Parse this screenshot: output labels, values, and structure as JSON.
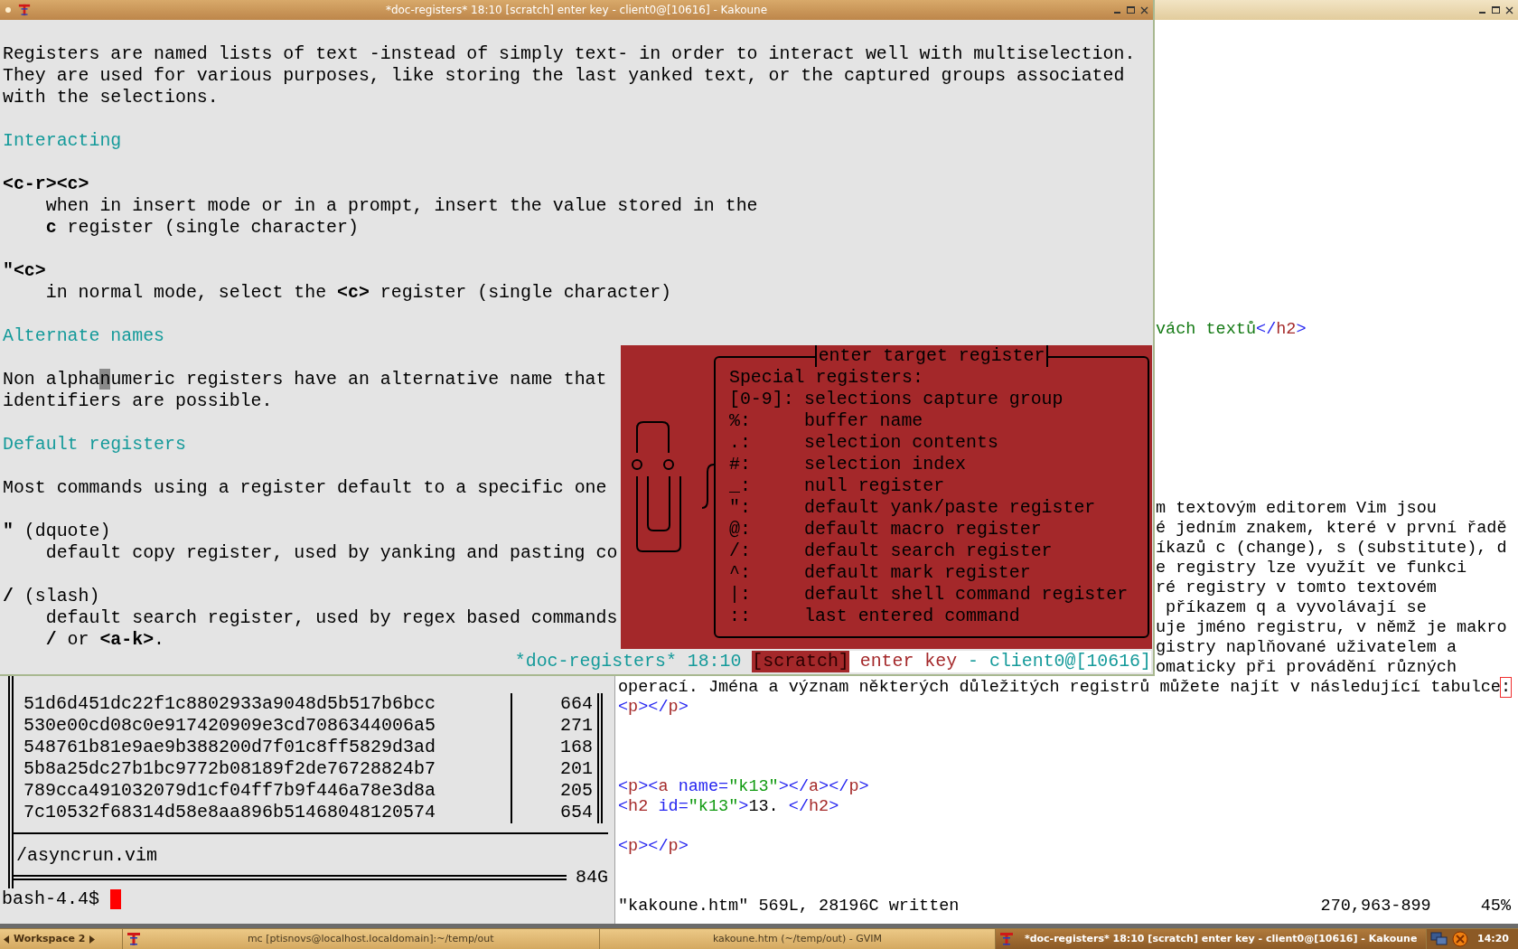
{
  "kakoune": {
    "title": "*doc-registers* 18:10 [scratch] enter key - client0@[10616] - Kakoune",
    "lines": [
      {
        "kind": "blank"
      },
      {
        "kind": "text",
        "text": "Registers are named lists of text -instead of simply text- in order to interact well with multiselection."
      },
      {
        "kind": "text",
        "text": "They are used for various purposes, like storing the last yanked text, or the captured groups associated"
      },
      {
        "kind": "text",
        "text": "with the selections."
      },
      {
        "kind": "blank"
      },
      {
        "kind": "heading",
        "text": "Interacting"
      },
      {
        "kind": "blank"
      },
      {
        "kind": "term",
        "text": "<c-r><c>"
      },
      {
        "kind": "indent",
        "text": "when in insert mode or in a prompt, insert the value stored in the"
      },
      {
        "kind": "indent",
        "text": "**c** register (single character)"
      },
      {
        "kind": "blank"
      },
      {
        "kind": "term",
        "text": "\"<c>"
      },
      {
        "kind": "indent",
        "text": "in normal mode, select the **<c>** register (single character)"
      },
      {
        "kind": "blank"
      },
      {
        "kind": "heading",
        "text": "Alternate names"
      },
      {
        "kind": "blank"
      },
      {
        "kind": "segments",
        "segments": [
          {
            "text": "Non alpha",
            "cursor": false
          },
          {
            "text": "n",
            "cursor": true
          },
          {
            "text": "umeric registers have an alternative name that",
            "cursor": false
          }
        ]
      },
      {
        "kind": "text",
        "text": "identifiers are possible."
      },
      {
        "kind": "blank"
      },
      {
        "kind": "heading",
        "text": "Default registers"
      },
      {
        "kind": "blank"
      },
      {
        "kind": "text",
        "text": "Most commands using a register default to a specific one"
      },
      {
        "kind": "blank"
      },
      {
        "kind": "text",
        "text": "**\"** (dquote)"
      },
      {
        "kind": "indent",
        "text": "default copy register, used by yanking and pasting co"
      },
      {
        "kind": "blank"
      },
      {
        "kind": "text",
        "text": "**/** (slash)"
      },
      {
        "kind": "indent",
        "text": "default search register, used by regex based commands"
      },
      {
        "kind": "indent",
        "text": "**/** or **<a-k>**."
      }
    ],
    "popup": {
      "title": "enter target register",
      "heading": "Special registers:",
      "registers": [
        {
          "key": "[0-9]:",
          "desc": "selections capture group"
        },
        {
          "key": "%:",
          "desc": "buffer name"
        },
        {
          "key": ".:",
          "desc": "selection contents"
        },
        {
          "key": "#:",
          "desc": "selection index"
        },
        {
          "key": "_:",
          "desc": "null register"
        },
        {
          "key": "\":",
          "desc": "default yank/paste register"
        },
        {
          "key": "@:",
          "desc": "default macro register"
        },
        {
          "key": "/:",
          "desc": "default search register"
        },
        {
          "key": "^:",
          "desc": "default mark register"
        },
        {
          "key": "|:",
          "desc": "default shell command register"
        },
        {
          "key": "::",
          "desc": "last entered command"
        }
      ]
    },
    "status": [
      {
        "kind": "buffer",
        "text": "*doc-registers*"
      },
      {
        "kind": "time",
        "text": "18:10"
      },
      {
        "kind": "mode",
        "text": "[scratch]"
      },
      {
        "kind": "prompt",
        "text": "enter key"
      },
      {
        "kind": "client",
        "text": "- client0@[10616]"
      }
    ]
  },
  "gvim": {
    "lines": [
      {
        "kind": "blank"
      },
      {
        "kind": "blank"
      },
      {
        "kind": "blank"
      },
      {
        "kind": "blank"
      },
      {
        "kind": "blank"
      },
      {
        "kind": "blank"
      },
      {
        "kind": "blank"
      },
      {
        "kind": "blank"
      },
      {
        "kind": "blank"
      },
      {
        "kind": "blank"
      },
      {
        "kind": "blank"
      },
      {
        "kind": "blank"
      },
      {
        "kind": "blank"
      },
      {
        "kind": "blank"
      },
      {
        "kind": "blank"
      },
      {
        "kind": "partial",
        "segments": [
          {
            "kind": "heading",
            "text": "vách textů"
          },
          {
            "kind": "tag",
            "text": "</"
          },
          {
            "kind": "name",
            "text": "h2"
          },
          {
            "kind": "tag",
            "text": ">"
          }
        ]
      },
      {
        "kind": "blank"
      },
      {
        "kind": "blank"
      },
      {
        "kind": "blank"
      },
      {
        "kind": "blank"
      },
      {
        "kind": "blank"
      },
      {
        "kind": "blank"
      },
      {
        "kind": "blank"
      },
      {
        "kind": "blank"
      },
      {
        "kind": "partial",
        "segments": [
          {
            "kind": "text",
            "text": "m textovým editorem Vim jsou"
          }
        ]
      },
      {
        "kind": "partial",
        "segments": [
          {
            "kind": "text",
            "text": "é jedním znakem, které v první řadě"
          }
        ]
      },
      {
        "kind": "partial",
        "segments": [
          {
            "kind": "text",
            "text": "íkazů c (change), s (substitute), d"
          }
        ]
      },
      {
        "kind": "partial",
        "segments": [
          {
            "kind": "text",
            "text": "e registry lze využít ve funkci"
          }
        ]
      },
      {
        "kind": "partial",
        "segments": [
          {
            "kind": "text",
            "text": "ré registry v tomto textovém"
          }
        ]
      },
      {
        "kind": "partial",
        "segments": [
          {
            "kind": "text",
            "text": " příkazem q a vyvolávají se"
          }
        ]
      },
      {
        "kind": "partial",
        "segments": [
          {
            "kind": "text",
            "text": "uje jméno registru, v němž je makro"
          }
        ]
      },
      {
        "kind": "partial",
        "segments": [
          {
            "kind": "text",
            "text": "gistry naplňované uživatelem a"
          }
        ]
      },
      {
        "kind": "partial",
        "segments": [
          {
            "kind": "text",
            "text": "omaticky při provádění různých"
          }
        ]
      },
      {
        "kind": "full",
        "segments": [
          {
            "kind": "text",
            "text": "operací. Jména a význam některých důležitých registrů můžete najít v následující tabulce"
          },
          {
            "kind": "cursor",
            "text": ":"
          }
        ]
      },
      {
        "kind": "full",
        "segments": [
          {
            "kind": "tag",
            "text": "<"
          },
          {
            "kind": "name",
            "text": "p"
          },
          {
            "kind": "tag",
            "text": "></"
          },
          {
            "kind": "name",
            "text": "p"
          },
          {
            "kind": "tag",
            "text": ">"
          }
        ]
      },
      {
        "kind": "blank"
      },
      {
        "kind": "blank"
      },
      {
        "kind": "blank"
      },
      {
        "kind": "full",
        "segments": [
          {
            "kind": "tag",
            "text": "<"
          },
          {
            "kind": "name",
            "text": "p"
          },
          {
            "kind": "tag",
            "text": "><"
          },
          {
            "kind": "name",
            "text": "a"
          },
          {
            "kind": "attr",
            "text": " name="
          },
          {
            "kind": "string",
            "text": "\"k13\""
          },
          {
            "kind": "tag",
            "text": "></"
          },
          {
            "kind": "name",
            "text": "a"
          },
          {
            "kind": "tag",
            "text": "></"
          },
          {
            "kind": "name",
            "text": "p"
          },
          {
            "kind": "tag",
            "text": ">"
          }
        ]
      },
      {
        "kind": "full",
        "segments": [
          {
            "kind": "tag",
            "text": "<"
          },
          {
            "kind": "name",
            "text": "h2"
          },
          {
            "kind": "attr",
            "text": " id="
          },
          {
            "kind": "string",
            "text": "\"k13\""
          },
          {
            "kind": "tag",
            "text": ">"
          },
          {
            "kind": "text",
            "text": "13. "
          },
          {
            "kind": "tag",
            "text": "</"
          },
          {
            "kind": "name",
            "text": "h2"
          },
          {
            "kind": "tag",
            "text": ">"
          }
        ]
      },
      {
        "kind": "blank"
      },
      {
        "kind": "full",
        "segments": [
          {
            "kind": "tag",
            "text": "<"
          },
          {
            "kind": "name",
            "text": "p"
          },
          {
            "kind": "tag",
            "text": "></"
          },
          {
            "kind": "name",
            "text": "p"
          },
          {
            "kind": "tag",
            "text": ">"
          }
        ]
      }
    ],
    "status": {
      "message": "\"kakoune.htm\" 569L, 28196C written",
      "position": "270,963-899",
      "percent": "45%"
    }
  },
  "mc": {
    "rows": [
      {
        "name": "51d6d451dc22f1c8802933a9048d5b517b6bcc",
        "size": "664"
      },
      {
        "name": "530e00cd08c0e917420909e3cd7086344006a5",
        "size": "271"
      },
      {
        "name": "548761b81e9ae9b388200d7f01c8ff5829d3ad",
        "size": "168"
      },
      {
        "name": "5b8a25dc27b1bc9772b08189f2de76728824b7",
        "size": "201"
      },
      {
        "name": "789cca491032079d1cf04ff7b9f446a78e3d8a",
        "size": "205"
      },
      {
        "name": "7c10532f68314d58e8aa896b51468048120574",
        "size": "654"
      }
    ],
    "path": "/asyncrun.vim",
    "disk": "84G",
    "prompt": "bash-4.4$"
  },
  "taskbar": {
    "workspace": "Workspace 2",
    "tasks": [
      {
        "kind": "terminal",
        "title": "mc [ptisnovs@localhost.localdomain]:~/temp/out",
        "selected": false
      },
      {
        "kind": "plain",
        "title": "kakoune.htm (~/temp/out) - GVIM",
        "selected": false
      },
      {
        "kind": "terminal",
        "title": "*doc-registers* 18:10 [scratch] enter key - client0@[10616] - Kakoune",
        "selected": true
      }
    ],
    "clock": "14:20"
  }
}
